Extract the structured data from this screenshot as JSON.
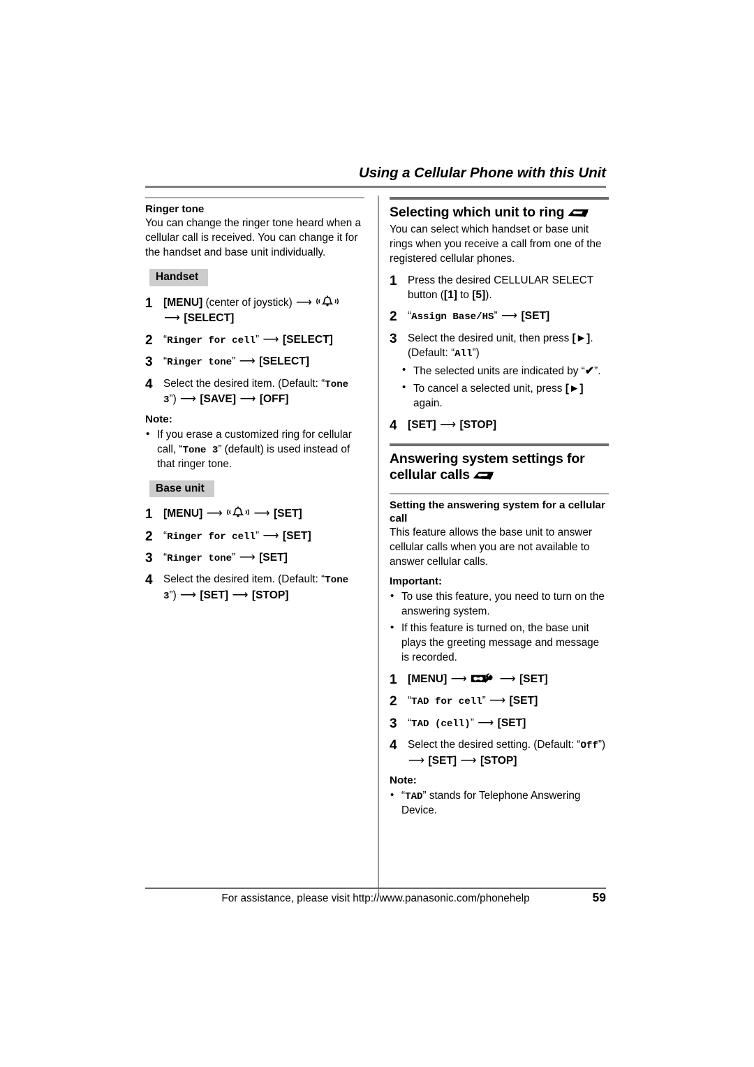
{
  "header": {
    "title": "Using a Cellular Phone with this Unit"
  },
  "left_column": {
    "section_title": "Ringer tone",
    "intro": "You can change the ringer tone heard when a cellular call is received. You can change it for the handset and base unit individually.",
    "handset_chip": "Handset",
    "handset_steps": [
      {
        "num": "1",
        "parts": [
          {
            "type": "key",
            "text": "[MENU]"
          },
          {
            "type": "text",
            "text": " (center of joystick) "
          },
          {
            "type": "arrow"
          },
          {
            "type": "icon",
            "name": "ringer-bell-icon"
          },
          {
            "type": "break"
          },
          {
            "type": "arrow"
          },
          {
            "type": "key",
            "text": "[SELECT]"
          }
        ]
      },
      {
        "num": "2",
        "parts": [
          {
            "type": "quote-lcd",
            "text": "Ringer for cell"
          },
          {
            "type": "arrow"
          },
          {
            "type": "key",
            "text": "[SELECT]"
          }
        ]
      },
      {
        "num": "3",
        "parts": [
          {
            "type": "quote-lcd",
            "text": "Ringer tone"
          },
          {
            "type": "arrow"
          },
          {
            "type": "key",
            "text": "[SELECT]"
          }
        ]
      },
      {
        "num": "4",
        "parts": [
          {
            "type": "text",
            "text": "Select the desired item. (Default: "
          },
          {
            "type": "quote-lcd-open",
            "text": "Tone 3"
          },
          {
            "type": "text",
            "text": ") "
          },
          {
            "type": "arrow"
          },
          {
            "type": "key",
            "text": "[SAVE]"
          },
          {
            "type": "arrow"
          },
          {
            "type": "key",
            "text": "[OFF]"
          }
        ]
      }
    ],
    "note_label": "Note:",
    "notes": [
      {
        "parts": [
          {
            "type": "text",
            "text": "If you erase a customized ring for cellular call, "
          },
          {
            "type": "quote-lcd",
            "text": "Tone 3"
          },
          {
            "type": "text",
            "text": " (default) is used instead of that ringer tone."
          }
        ]
      }
    ],
    "base_chip": "Base unit",
    "base_steps": [
      {
        "num": "1",
        "parts": [
          {
            "type": "key",
            "text": "[MENU]"
          },
          {
            "type": "arrow"
          },
          {
            "type": "icon",
            "name": "ringer-bell-icon"
          },
          {
            "type": "arrow"
          },
          {
            "type": "key",
            "text": "[SET]"
          }
        ]
      },
      {
        "num": "2",
        "parts": [
          {
            "type": "quote-lcd",
            "text": "Ringer for cell"
          },
          {
            "type": "arrow"
          },
          {
            "type": "key",
            "text": "[SET]"
          }
        ]
      },
      {
        "num": "3",
        "parts": [
          {
            "type": "quote-lcd",
            "text": "Ringer tone"
          },
          {
            "type": "arrow"
          },
          {
            "type": "key",
            "text": "[SET]"
          }
        ]
      },
      {
        "num": "4",
        "parts": [
          {
            "type": "text",
            "text": "Select the desired item. (Default: "
          },
          {
            "type": "quote-lcd-open",
            "text": "Tone 3"
          },
          {
            "type": "text",
            "text": ") "
          },
          {
            "type": "arrow"
          },
          {
            "type": "key",
            "text": "[SET]"
          },
          {
            "type": "arrow"
          },
          {
            "type": "key",
            "text": "[STOP]"
          }
        ]
      }
    ]
  },
  "right_column": {
    "section1_title": "Selecting which unit to ring",
    "section1_icon": "base-unit-icon",
    "section1_intro": "You can select which handset or base unit rings when you receive a call from one of the registered cellular phones.",
    "section1_steps": [
      {
        "num": "1",
        "parts": [
          {
            "type": "text",
            "text": "Press the desired CELLULAR SELECT button ("
          },
          {
            "type": "key",
            "text": "[1]"
          },
          {
            "type": "text",
            "text": " to "
          },
          {
            "type": "key",
            "text": "[5]"
          },
          {
            "type": "text",
            "text": ")."
          }
        ]
      },
      {
        "num": "2",
        "parts": [
          {
            "type": "quote-lcd",
            "text": "Assign Base/HS"
          },
          {
            "type": "arrow"
          },
          {
            "type": "key",
            "text": "[SET]"
          }
        ]
      },
      {
        "num": "3",
        "parts": [
          {
            "type": "text",
            "text": "Select the desired unit, then press "
          },
          {
            "type": "key",
            "text": "[►]"
          },
          {
            "type": "text",
            "text": ". (Default: "
          },
          {
            "type": "quote-lcd",
            "text": "All"
          },
          {
            "type": "text",
            "text": ")"
          }
        ],
        "bullets": [
          {
            "parts": [
              {
                "type": "text",
                "text": "The selected units are indicated by "
              },
              {
                "type": "quote-check"
              },
              {
                "type": "text",
                "text": "."
              }
            ]
          },
          {
            "parts": [
              {
                "type": "text",
                "text": "To cancel a selected unit, press "
              },
              {
                "type": "key",
                "text": "[►]"
              },
              {
                "type": "text",
                "text": " again."
              }
            ]
          }
        ]
      },
      {
        "num": "4",
        "parts": [
          {
            "type": "key",
            "text": "[SET]"
          },
          {
            "type": "arrow"
          },
          {
            "type": "key",
            "text": "[STOP]"
          }
        ]
      }
    ],
    "section2_title_line1": "Answering system settings for",
    "section2_title_line2": "cellular calls",
    "section2_icon": "base-unit-icon",
    "section2_subtitle": "Setting the answering system for a cellular call",
    "section2_intro": "This feature allows the base unit to answer cellular calls when you are not available to answer cellular calls.",
    "important_label": "Important:",
    "important_bullets": [
      {
        "parts": [
          {
            "type": "text",
            "text": "To use this feature, you need to turn on the answering system."
          }
        ]
      },
      {
        "parts": [
          {
            "type": "text",
            "text": "If this feature is turned on, the base unit plays the greeting message and message is recorded."
          }
        ]
      }
    ],
    "section2_steps": [
      {
        "num": "1",
        "parts": [
          {
            "type": "key",
            "text": "[MENU]"
          },
          {
            "type": "arrow"
          },
          {
            "type": "icon",
            "name": "answering-system-icon"
          },
          {
            "type": "arrow"
          },
          {
            "type": "key",
            "text": "[SET]"
          }
        ]
      },
      {
        "num": "2",
        "parts": [
          {
            "type": "quote-lcd",
            "text": "TAD for cell"
          },
          {
            "type": "arrow"
          },
          {
            "type": "key",
            "text": "[SET]"
          }
        ]
      },
      {
        "num": "3",
        "parts": [
          {
            "type": "quote-lcd",
            "text": "TAD (cell)"
          },
          {
            "type": "arrow"
          },
          {
            "type": "key",
            "text": "[SET]"
          }
        ]
      },
      {
        "num": "4",
        "parts": [
          {
            "type": "text",
            "text": "Select the desired setting. (Default: "
          },
          {
            "type": "quote-lcd-open",
            "text": "Off"
          },
          {
            "type": "text",
            "text": ") "
          },
          {
            "type": "arrow"
          },
          {
            "type": "key",
            "text": "[SET]"
          },
          {
            "type": "arrow"
          },
          {
            "type": "key",
            "text": "[STOP]"
          }
        ]
      }
    ],
    "note_label": "Note:",
    "notes": [
      {
        "parts": [
          {
            "type": "quote-lcd",
            "text": "TAD"
          },
          {
            "type": "text",
            "text": " stands for Telephone Answering Device."
          }
        ]
      }
    ]
  },
  "footer": {
    "text": "For assistance, please visit http://www.panasonic.com/phonehelp",
    "page_number": "59"
  },
  "colors": {
    "text": "#000000",
    "rule_gray": "#808080",
    "rule_light": "#a6a6a6",
    "chip_bg": "#cccccc",
    "divider": "#999999"
  }
}
